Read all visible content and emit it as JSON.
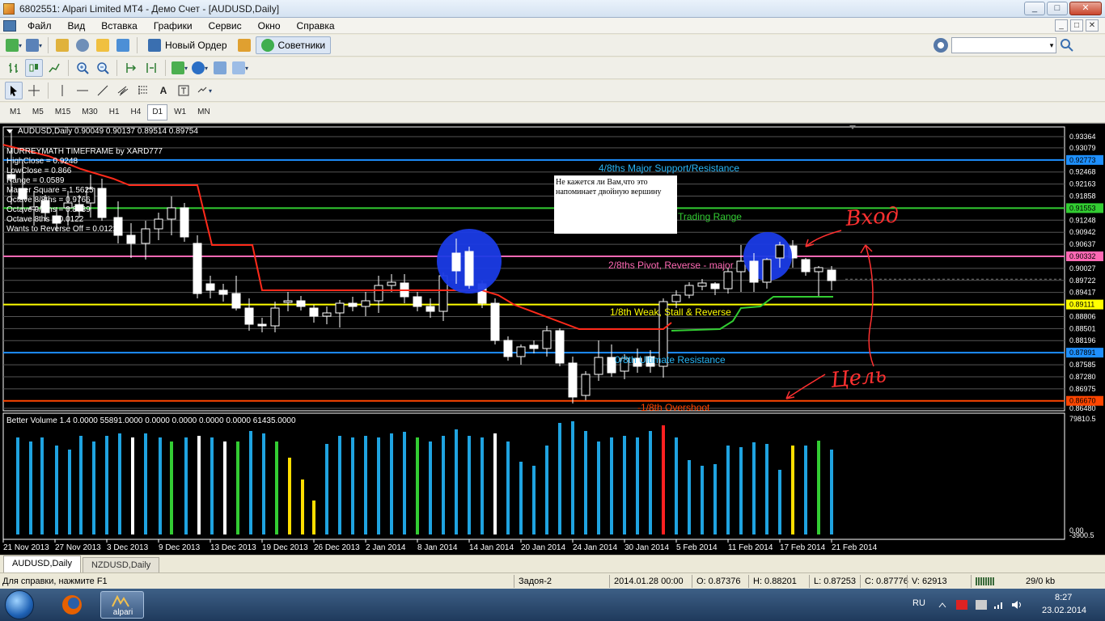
{
  "window": {
    "title": "6802551: Alpari Limited MT4 - Демо Счет - [AUDUSD,Daily]",
    "buttons": [
      "_",
      "□",
      "✕"
    ]
  },
  "menu": {
    "items": [
      "Файл",
      "Вид",
      "Вставка",
      "Графики",
      "Сервис",
      "Окно",
      "Справка"
    ],
    "mdi_buttons": [
      "_",
      "□",
      "✕"
    ]
  },
  "toolbar1": {
    "new_order_label": "Новый Ордер",
    "experts_label": "Советники",
    "search_value": ""
  },
  "timeframes": {
    "items": [
      "M1",
      "M5",
      "M15",
      "M30",
      "H1",
      "H4",
      "D1",
      "W1",
      "MN"
    ],
    "active": "D1"
  },
  "chart": {
    "header": "AUDUSD,Daily  0.90049 0.90137 0.89514 0.89754",
    "indicator_title": "MURREYMATH TIMEFRAME by XARD777",
    "indicator_lines": [
      "HighClose = 0.9248",
      "LowClose = 0.866",
      "Range = 0.0589",
      "Master Square = 1.5625",
      "Octave 8/8ths = 0.9766",
      "Octave 0/8ths = 0.8789",
      "Octave 8ths = 0.0122",
      "Wants to Reverse Off = 0.0122"
    ],
    "levels": [
      {
        "label": "4/8ths Major Support/Resistance",
        "color": "#29b6f6"
      },
      {
        "label": "Trading Range",
        "color": "#32cd32"
      },
      {
        "label": "2/8ths Pivot, Reverse - major",
        "color": "#ff69b4"
      },
      {
        "label": "1/8th Weak, Stall & Reverse",
        "color": "#ffff00"
      },
      {
        "label": "0/8th Ultimate Resistance",
        "color": "#29b6f6"
      },
      {
        "label": "-1/8th Overshoot",
        "color": "#ff4500"
      }
    ],
    "price_scale": [
      "0.93364",
      "0.93079",
      "0.92773",
      "0.92468",
      "0.92163",
      "0.91858",
      "0.91553",
      "0.91248",
      "0.90942",
      "0.90637",
      "0.90332",
      "0.90027",
      "0.89722",
      "0.89417",
      "0.89111",
      "0.88806",
      "0.88501",
      "0.88196",
      "0.87891",
      "0.87585",
      "0.87280",
      "0.86975",
      "0.86670",
      "0.86480"
    ],
    "highlighted_prices": [
      {
        "value": "0.92773",
        "color": "#1e90ff"
      },
      {
        "value": "0.91553",
        "color": "#32cd32"
      },
      {
        "value": "0.90332",
        "color": "#ff69b4"
      },
      {
        "value": "0.89111",
        "color": "#ffff00"
      },
      {
        "value": "0.87891",
        "color": "#1e90ff"
      },
      {
        "value": "0.86670",
        "color": "#ff4500"
      }
    ],
    "note": "Не кажется ли Вам,что это напоминает двойную вершину",
    "handwritten": {
      "top": "Вход",
      "bottom": "Цель"
    },
    "date_axis": [
      "21 Nov 2013",
      "27 Nov 2013",
      "3 Dec 2013",
      "9 Dec 2013",
      "13 Dec 2013",
      "19 Dec 2013",
      "26 Dec 2013",
      "2 Jan 2014",
      "8 Jan 2014",
      "14 Jan 2014",
      "20 Jan 2014",
      "24 Jan 2014",
      "30 Jan 2014",
      "5 Feb 2014",
      "11 Feb 2014",
      "17 Feb 2014",
      "21 Feb 2014"
    ],
    "volume_header": "Better Volume 1.4  0.0000 55891.0000 0.0000 0.0000 0.0000 0.0000 61435.0000",
    "volume_scale": [
      "79810.5",
      "0.00",
      "-3900.5"
    ]
  },
  "tabs": {
    "items": [
      "AUDUSD,Daily",
      "NZDUSD,Daily"
    ],
    "active": "AUDUSD,Daily"
  },
  "status": {
    "help": "Для справки, нажмите F1",
    "profile": "Задоя-2",
    "datetime": "2014.01.28 00:00",
    "open": "O: 0.87376",
    "high": "H: 0.88201",
    "low": "L: 0.87253",
    "close": "C: 0.87776",
    "volume": "V: 62913",
    "traffic": "29/0 kb"
  },
  "taskbar": {
    "language": "RU",
    "time": "8:27",
    "date": "23.02.2014",
    "alpari_label": "alpari"
  }
}
